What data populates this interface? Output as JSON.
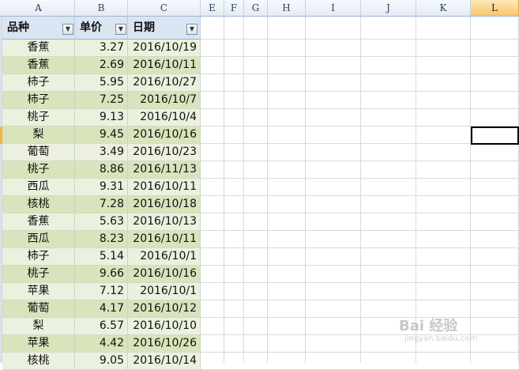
{
  "columns": [
    "A",
    "B",
    "C",
    "E",
    "F",
    "G",
    "H",
    "I",
    "J",
    "K",
    "L"
  ],
  "header": {
    "col1": "品种",
    "col2": "单价",
    "col3": "日期"
  },
  "rows": [
    [
      "香蕉",
      "3.27",
      "2016/10/19"
    ],
    [
      "香蕉",
      "2.69",
      "2016/10/11"
    ],
    [
      "柿子",
      "5.95",
      "2016/10/27"
    ],
    [
      "柿子",
      "7.25",
      "2016/10/7"
    ],
    [
      "桃子",
      "9.13",
      "2016/10/4"
    ],
    [
      "梨",
      "9.45",
      "2016/10/16"
    ],
    [
      "葡萄",
      "3.49",
      "2016/10/23"
    ],
    [
      "桃子",
      "8.86",
      "2016/11/13"
    ],
    [
      "西瓜",
      "9.31",
      "2016/10/11"
    ],
    [
      "核桃",
      "7.28",
      "2016/10/18"
    ],
    [
      "香蕉",
      "5.63",
      "2016/10/13"
    ],
    [
      "西瓜",
      "8.23",
      "2016/10/11"
    ],
    [
      "柿子",
      "5.14",
      "2016/10/1"
    ],
    [
      "桃子",
      "9.66",
      "2016/10/16"
    ],
    [
      "苹果",
      "7.12",
      "2016/10/1"
    ],
    [
      "葡萄",
      "4.17",
      "2016/10/12"
    ],
    [
      "梨",
      "6.57",
      "2016/10/10"
    ],
    [
      "苹果",
      "4.42",
      "2016/10/26"
    ],
    [
      "核桃",
      "9.05",
      "2016/10/14"
    ]
  ],
  "watermark": {
    "logo": "Bai 经验",
    "url": "jingyan.baidu.com"
  },
  "colors": {
    "band_light": "#ebf1de",
    "band_dark": "#d8e4bc",
    "header_bg": "#dbe5f1",
    "selected_col": "#f9c56a"
  }
}
